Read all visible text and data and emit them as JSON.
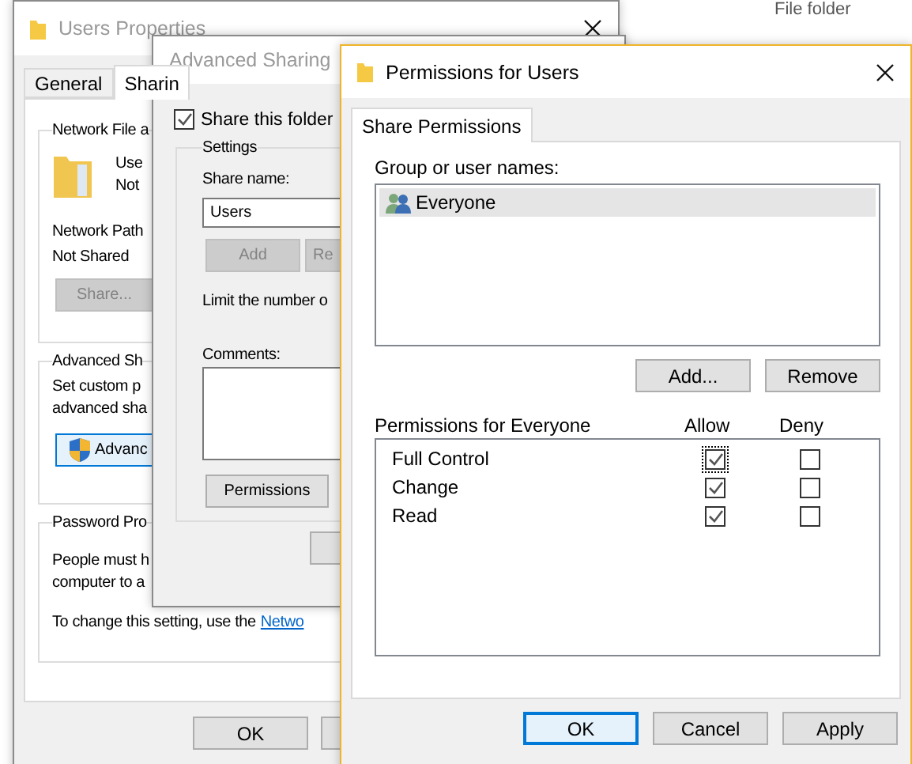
{
  "background": {
    "label": "File folder"
  },
  "users_properties": {
    "title": "Users Properties",
    "active": false,
    "tabs": [
      {
        "label": "General",
        "selected": false
      },
      {
        "label": "Sharin",
        "selected": true
      }
    ],
    "network_group": {
      "title": "Network File a",
      "name_lines": [
        "Use",
        "Not"
      ],
      "path_label": "Network Path",
      "path_value": "Not Shared",
      "share_button": {
        "label": "Share...",
        "disabled": true
      }
    },
    "advanced_group": {
      "title": "Advanced Sh",
      "description": [
        "Set custom p",
        "advanced sha"
      ],
      "button": "Advanc"
    },
    "password_group": {
      "title": "Password Pro",
      "description": [
        "People must h",
        "computer to a"
      ],
      "note": "To change this setting, use the",
      "link": "Netwo"
    },
    "buttons": [
      "OK"
    ]
  },
  "advanced_sharing": {
    "title": "Advanced Sharing",
    "active": false,
    "share_checkbox": {
      "label": "Share this folder",
      "checked": true
    },
    "settings": {
      "title": "Settings",
      "share_name_label": "Share name:",
      "share_name": "Users",
      "buttons": [
        {
          "label": "Add",
          "disabled": true
        },
        {
          "label": "Re",
          "disabled": true
        }
      ],
      "limit_text": "Limit the number o",
      "comments_label": "Comments:",
      "permissions_button": "Permissions"
    }
  },
  "permissions": {
    "title": "Permissions for Users",
    "active": true,
    "tabs": [
      {
        "label": "Share Permissions",
        "selected": true
      }
    ],
    "group_label": "Group or user names:",
    "users": [
      {
        "name": "Everyone",
        "selected": true
      }
    ],
    "user_buttons": [
      "Add...",
      "Remove"
    ],
    "header": {
      "label": "Permissions for Everyone",
      "allow": "Allow",
      "deny": "Deny"
    },
    "rows": [
      {
        "name": "Full Control",
        "allow": true,
        "deny": false,
        "focused": true
      },
      {
        "name": "Change",
        "allow": true,
        "deny": false,
        "focused": false
      },
      {
        "name": "Read",
        "allow": true,
        "deny": false,
        "focused": false
      }
    ],
    "buttons": [
      {
        "label": "OK",
        "default": true
      },
      {
        "label": "Cancel",
        "default": false
      },
      {
        "label": "Apply",
        "default": false
      }
    ]
  }
}
